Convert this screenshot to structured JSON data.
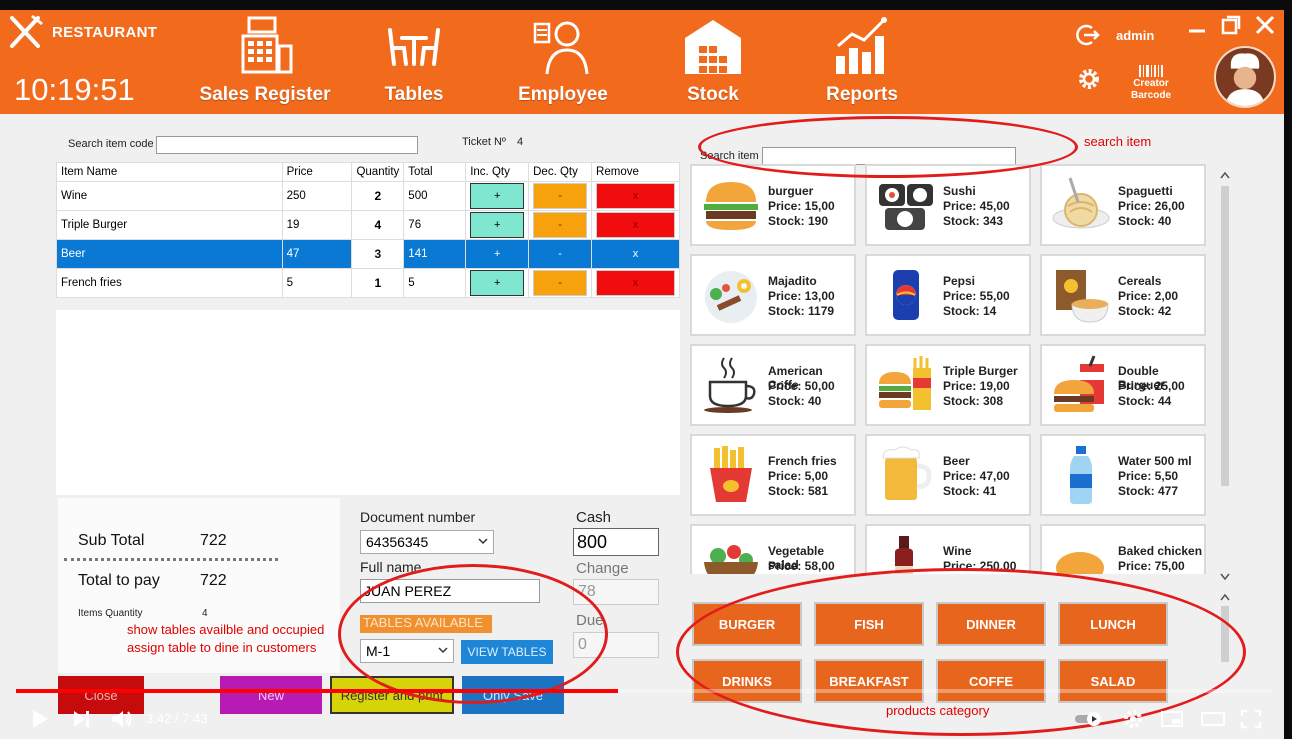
{
  "header": {
    "brand": "RESTAURANT",
    "clock": "10:19:51",
    "nav": [
      {
        "label": "Sales Register",
        "icon": "cash-register-icon"
      },
      {
        "label": "Tables",
        "icon": "tables-icon"
      },
      {
        "label": "Employee",
        "icon": "employee-icon"
      },
      {
        "label": "Stock",
        "icon": "warehouse-icon"
      },
      {
        "label": "Reports",
        "icon": "chart-icon"
      }
    ],
    "user": "admin",
    "barcode_label_1": "Creator",
    "barcode_label_2": "Barcode"
  },
  "order": {
    "search_code_label": "Search item code",
    "search_code_value": "",
    "ticket_label": "Ticket Nº",
    "ticket_number": "4",
    "columns": [
      "Item Name",
      "Price",
      "Quantity",
      "Total",
      "Inc. Qty",
      "Dec. Qty",
      "Remove"
    ],
    "rows": [
      {
        "name": "Wine",
        "price": "250",
        "qty": "2",
        "total": "500",
        "inc": "+",
        "dec": "-",
        "remove": "x"
      },
      {
        "name": "Triple Burger",
        "price": "19",
        "qty": "4",
        "total": "76",
        "inc": "+",
        "dec": "-",
        "remove": "x"
      },
      {
        "name": "Beer",
        "price": "47",
        "qty": "3",
        "total": "141",
        "inc": "+",
        "dec": "-",
        "remove": "x"
      },
      {
        "name": "French fries",
        "price": "5",
        "qty": "1",
        "total": "5",
        "inc": "+",
        "dec": "-",
        "remove": "x"
      }
    ],
    "selected_row": 2
  },
  "totals": {
    "subtotal_label": "Sub Total",
    "subtotal": "722",
    "total_label": "Total to pay",
    "total": "722",
    "items_qty_label": "Items Quantity",
    "items_qty": "4"
  },
  "document": {
    "doc_label": "Document number",
    "doc_value": "64356345",
    "name_label": "Full name",
    "name_value": "JUAN PEREZ",
    "tables_label": "TABLES AVAILABLE",
    "table_value": "M-1",
    "view_tables": "VIEW TABLES"
  },
  "payment": {
    "cash_label": "Cash",
    "cash_value": "800",
    "change_label": "Change",
    "change_value": "78",
    "due_label": "Due",
    "due_value": "0"
  },
  "actions": {
    "close": "Close",
    "new": "New",
    "register_print": "Register and print",
    "only_save": "Only Save"
  },
  "products": {
    "search_label": "Search item",
    "search_value": "",
    "items": [
      {
        "name": "burguer",
        "price": "Price: 15,00",
        "stock": "Stock: 190",
        "icon": "burger-icon"
      },
      {
        "name": "Sushi",
        "price": "Price: 45,00",
        "stock": "Stock: 343",
        "icon": "sushi-icon"
      },
      {
        "name": "Spaguetti",
        "price": "Price: 26,00",
        "stock": "Stock: 40",
        "icon": "spaghetti-icon"
      },
      {
        "name": "Majadito",
        "price": "Price: 13,00",
        "stock": "Stock: 1179",
        "icon": "plate-icon"
      },
      {
        "name": "Pepsi",
        "price": "Price: 55,00",
        "stock": "Stock: 14",
        "icon": "soda-can-icon"
      },
      {
        "name": "Cereals",
        "price": "Price: 2,00",
        "stock": "Stock: 42",
        "icon": "cereal-icon"
      },
      {
        "name": "American Coffe",
        "price": "Price: 50,00",
        "stock": "Stock: 40",
        "icon": "coffee-cup-icon"
      },
      {
        "name": "Triple Burger",
        "price": "Price: 19,00",
        "stock": "Stock: 308",
        "icon": "combo-meal-icon"
      },
      {
        "name": "Double Burguer",
        "price": "Price: 25,00",
        "stock": "Stock: 44",
        "icon": "burger-drink-icon"
      },
      {
        "name": "French fries",
        "price": "Price: 5,00",
        "stock": "Stock: 581",
        "icon": "fries-icon"
      },
      {
        "name": "Beer",
        "price": "Price: 47,00",
        "stock": "Stock: 41",
        "icon": "beer-mug-icon"
      },
      {
        "name": "Water 500 ml",
        "price": "Price: 5,50",
        "stock": "Stock: 477",
        "icon": "water-bottle-icon"
      },
      {
        "name": "Vegetable salad",
        "price": "Price: 58,00",
        "stock": "",
        "icon": "salad-icon"
      },
      {
        "name": "Wine",
        "price": "Price: 250,00",
        "stock": "",
        "icon": "wine-icon"
      },
      {
        "name": "Baked chicken",
        "price": "Price: 75,00",
        "stock": "",
        "icon": "chicken-icon"
      }
    ]
  },
  "categories": [
    "BURGER",
    "FISH",
    "DINNER",
    "LUNCH",
    "DRINKS",
    "BREAKFAST",
    "COFFE",
    "SALAD"
  ],
  "annotations": {
    "search": "search item",
    "tables_1": "show tables availble and occupied",
    "tables_2": "assign table to dine in customers",
    "category": "products category"
  },
  "video": {
    "time": "3:42 / 7:43",
    "progress": 0.479
  },
  "colors": {
    "header": "#f26a1b",
    "selected_row": "#0a79d4",
    "inc": "#7fe6cf",
    "dec": "#f7a10c",
    "remove": "#f10d0d",
    "category": "#e8651e",
    "annotation": "#e21b1b"
  }
}
